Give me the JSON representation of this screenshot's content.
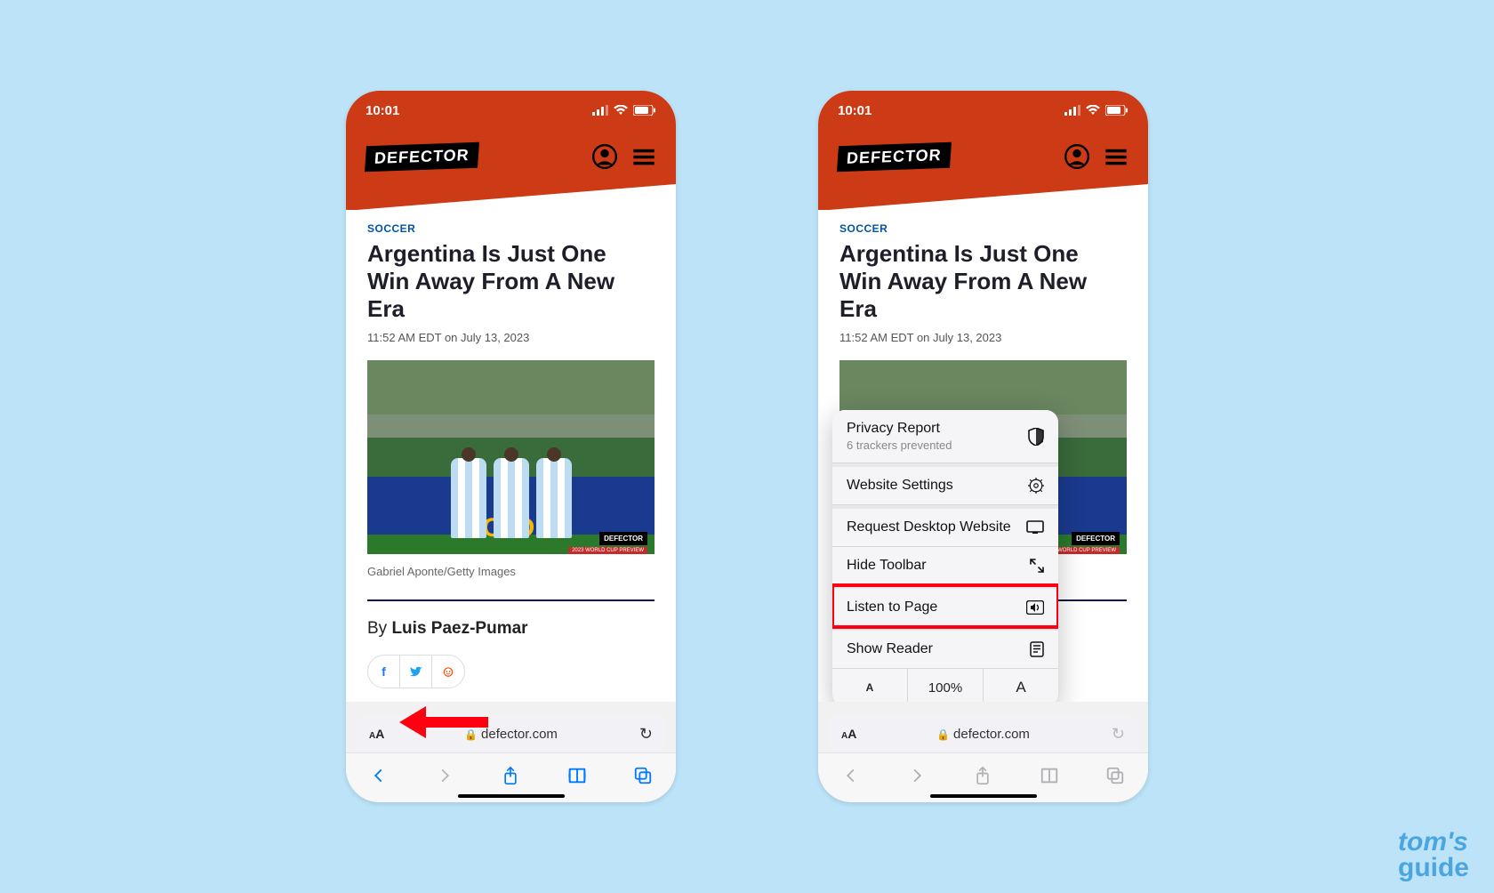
{
  "status": {
    "time": "10:01"
  },
  "site": {
    "logo": "DEFECTOR"
  },
  "article": {
    "category": "SOCCER",
    "headline": "Argentina Is Just One Win Away From A New Era",
    "timestamp": "11:52 AM EDT on July 13, 2023",
    "caption": "Gabriel Aponte/Getty Images",
    "byline_prefix": "By ",
    "author": "Luis Paez-Pumar",
    "image_badge": "DEFECTOR",
    "image_subbadge": "2023 WORLD CUP PREVIEW"
  },
  "safari": {
    "url": "defector.com"
  },
  "menu": {
    "privacy_title": "Privacy Report",
    "privacy_sub": "6 trackers prevented",
    "website_settings": "Website Settings",
    "request_desktop": "Request Desktop Website",
    "hide_toolbar": "Hide Toolbar",
    "listen": "Listen to Page",
    "show_reader": "Show Reader",
    "zoom_level": "100%"
  },
  "watermark": {
    "line1": "tom's",
    "line2": "guide"
  }
}
